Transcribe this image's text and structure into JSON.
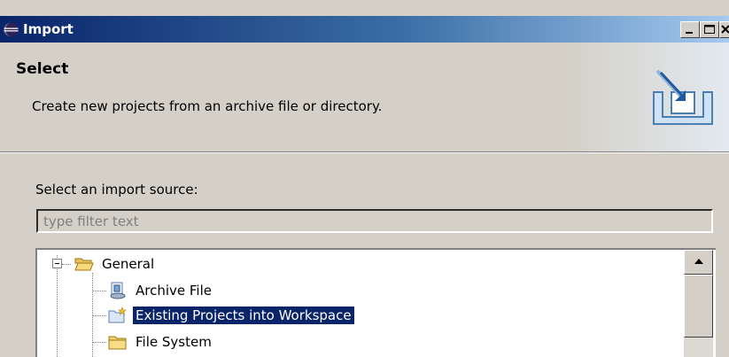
{
  "window": {
    "title": "Import",
    "icon": "eclipse-icon",
    "controls": [
      "minimize",
      "maximize",
      "close"
    ]
  },
  "header": {
    "title": "Select",
    "description": "Create new projects from an archive file or directory.",
    "banner_icon": "import-tray-icon"
  },
  "main": {
    "source_label": "Select an import source:",
    "filter": {
      "value": "",
      "placeholder": "type filter text"
    },
    "tree": {
      "items": [
        {
          "label": "General",
          "icon": "open-folder-icon",
          "expanded": true,
          "level": 0,
          "selected": false
        },
        {
          "label": "Archive File",
          "icon": "archive-file-icon",
          "level": 1,
          "selected": false
        },
        {
          "label": "Existing Projects into Workspace",
          "icon": "new-project-icon",
          "level": 1,
          "selected": true
        },
        {
          "label": "File System",
          "icon": "folder-icon",
          "level": 1,
          "selected": false
        }
      ]
    }
  },
  "colors": {
    "titlebar_start": "#0a246a",
    "titlebar_end": "#a6caf0",
    "selection": "#0a246a",
    "dialog_bg": "#d4d0c8"
  }
}
